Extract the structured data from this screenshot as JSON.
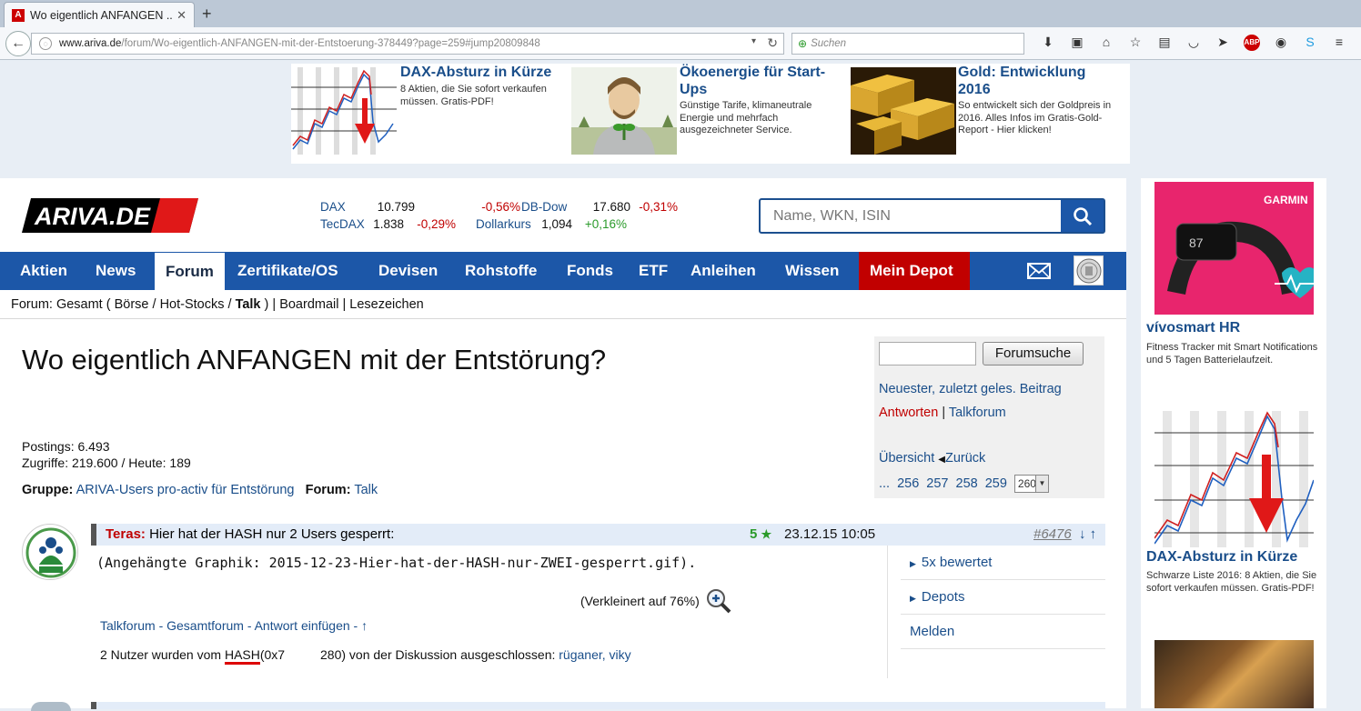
{
  "browser": {
    "tab_title": "Wo eigentlich ANFANGEN ...",
    "url_host": "www.ariva.de",
    "url_path": "/forum/Wo-eigentlich-ANFANGEN-mit-der-Entstoerung-378449?page=259#jump20809848",
    "search_placeholder": "Suchen"
  },
  "ads": [
    {
      "title": "DAX-Absturz in Kürze",
      "text": "8 Aktien, die Sie sofort verkaufen müssen. Gratis-PDF!"
    },
    {
      "title": "Ökoenergie für Start-Ups",
      "text": "Günstige Tarife, klimaneutrale Energie und mehrfach ausgezeichneter Service."
    },
    {
      "title": "Gold: Entwicklung 2016",
      "text": "So entwickelt sich der Goldpreis in 2016. Alles Infos im Gratis-Gold-Report - Hier klicken!"
    }
  ],
  "logo_text": "ARIVA.DE",
  "ticker": [
    {
      "name": "DAX",
      "value": "10.799",
      "change": "-0,56%",
      "dir": "neg"
    },
    {
      "name": "TecDAX",
      "value": "1.838",
      "change": "-0,29%",
      "dir": "neg"
    },
    {
      "name": "DB-Dow",
      "value": "17.680",
      "change": "-0,31%",
      "dir": "neg"
    },
    {
      "name": "Dollarkurs",
      "value": "1,094",
      "change": "+0,16%",
      "dir": "pos"
    }
  ],
  "site_search": {
    "placeholder": "Name, WKN, ISIN"
  },
  "nav": [
    "Aktien",
    "News",
    "Forum",
    "Zertifikate/OS",
    "Devisen",
    "Rohstoffe",
    "Fonds",
    "ETF",
    "Anleihen",
    "Wissen",
    "Mein Depot"
  ],
  "breadcrumb": {
    "prefix": "Forum: Gesamt ( Börse / Hot-Stocks / ",
    "current": "Talk",
    "suffix": " ) | Boardmail | Lesezeichen"
  },
  "thread": {
    "title": "Wo eigentlich ANFANGEN mit der Entstörung?",
    "postings": "Postings: 6.493",
    "views": "Zugriffe: 219.600 / Heute: 189",
    "gruppe_label": "Gruppe:",
    "gruppe_value": "ARIVA-Users pro-activ für Entstörung",
    "forum_label": "Forum:",
    "forum_value": "Talk"
  },
  "sidebox": {
    "button": "Forumsuche",
    "newest": "Neuester, zuletzt geles. Beitrag",
    "answer": "Antworten",
    "sep": " | ",
    "talkforum": "Talkforum",
    "overview": "Übersicht",
    "back": "Zurück",
    "ellipsis": "...",
    "pages": [
      "256",
      "257",
      "258",
      "259"
    ],
    "page_select": "260"
  },
  "post": {
    "author": "Teras:",
    "subject": "Hier hat der HASH nur 2 Users gesperrt:",
    "rating": "5",
    "date": "23.12.15 10:05",
    "number": "#6476",
    "arrows": "↓ ↑",
    "attachment": "(Angehängte Graphik: 2015-12-23-Hier-hat-der-HASH-nur-ZWEI-gesperrt.gif).",
    "shrunk": "(Verkleinert auf 76%)",
    "footer": "Talkforum - Gesamtforum - Antwort einfügen - ↑",
    "excluded_pre": "2 Nutzer wurden vom ",
    "excluded_hash": "HASH",
    "excluded_mid": "(0x7 ",
    "excluded_mid2": " 280) von der Diskussion ausgeschlossen: ",
    "excluded_users": "rüganer, viky",
    "side_links": [
      "5x bewertet",
      "Depots",
      "Melden"
    ]
  },
  "right_ads": {
    "brand": "GARMIN",
    "watch_text": "87",
    "product": "vívosmart HR",
    "product_text": "Fitness Tracker mit Smart Notifications und 5 Tagen Batterielaufzeit.",
    "dax_title": "DAX-Absturz in Kürze",
    "dax_text": "Schwarze Liste 2016: 8 Aktien, die Sie sofort verkaufen müssen. Gratis-PDF!"
  }
}
